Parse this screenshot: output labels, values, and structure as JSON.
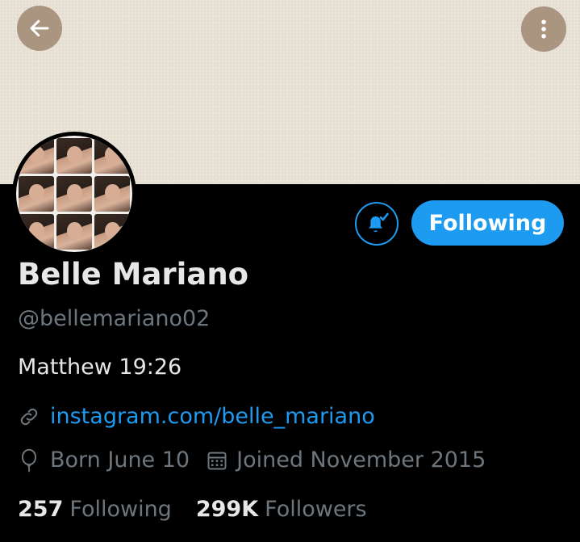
{
  "profile": {
    "name": "Belle Mariano",
    "handle": "@bellemariano02",
    "bio": "Matthew 19:26",
    "link": "instagram.com/belle_mariano",
    "born": "Born June 10",
    "joined": "Joined November 2015"
  },
  "actions": {
    "follow_label": "Following"
  },
  "stats": {
    "following_count": "257",
    "following_label": "Following",
    "followers_count": "299K",
    "followers_label": "Followers"
  },
  "icons": {
    "back": "arrow-left-icon",
    "more": "vertical-dots-icon",
    "notify": "bell-check-icon",
    "link": "link-icon",
    "born": "balloon-icon",
    "joined": "calendar-icon"
  },
  "colors": {
    "accent": "#1d9bf0",
    "background": "#000000",
    "muted": "#6e767d",
    "banner": "#e9e2d6"
  }
}
